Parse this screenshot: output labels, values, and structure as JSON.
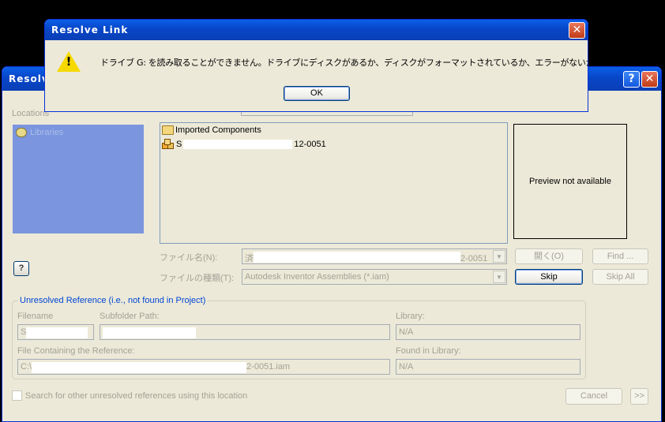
{
  "main_dialog": {
    "title": "Resolv",
    "help_btn": "?",
    "close_btn": "✕",
    "locations_label": "Locations",
    "locations": [
      {
        "label": "Libraries",
        "icon": "library-icon"
      }
    ],
    "files": [
      {
        "label": "Imported Components",
        "icon": "folder-icon"
      },
      {
        "label_prefix": "S",
        "label_suffix": "12-0051",
        "icon": "assembly-icon"
      }
    ],
    "preview_text": "Preview not available",
    "filename_label": "ファイル名(N):",
    "filename_prefix": "済",
    "filename_suffix": "2-0051",
    "filetype_label": "ファイルの種類(T):",
    "filetype_value": "Autodesk Inventor Assemblies (*.iam)",
    "buttons": {
      "open": "開く(O)",
      "find": "Find ...",
      "skip": "Skip",
      "skip_all": "Skip All",
      "cancel": "Cancel",
      "more": ">>"
    },
    "help_small": "?",
    "unresolved": {
      "title": "Unresolved Reference (i.e., not found in Project)",
      "filename_label": "Filename",
      "filename_value": "S",
      "subfolder_label": "Subfolder Path:",
      "library_label": "Library:",
      "library_value": "N/A",
      "containing_label": "File Containing the Reference:",
      "containing_prefix": "C:\\",
      "containing_suffix": "2-0051.iam",
      "found_label": "Found in Library:",
      "found_value": "N/A"
    },
    "search_checkbox_label": "Search for other unresolved references using this location"
  },
  "popup": {
    "title": "Resolve Link",
    "close_btn": "✕",
    "message": "ドライブ G: を読み取ることができません。ドライブにディスクがあるか、ディスクがフォーマットされているか、エラーがないか調べてください。",
    "ok_label": "OK",
    "icon": "warning-icon"
  },
  "colors": {
    "titlebar": "#0a5fe8",
    "dialog_bg": "#ece9d8",
    "locations_bg": "#7b96df",
    "group_title": "#0046d5"
  }
}
